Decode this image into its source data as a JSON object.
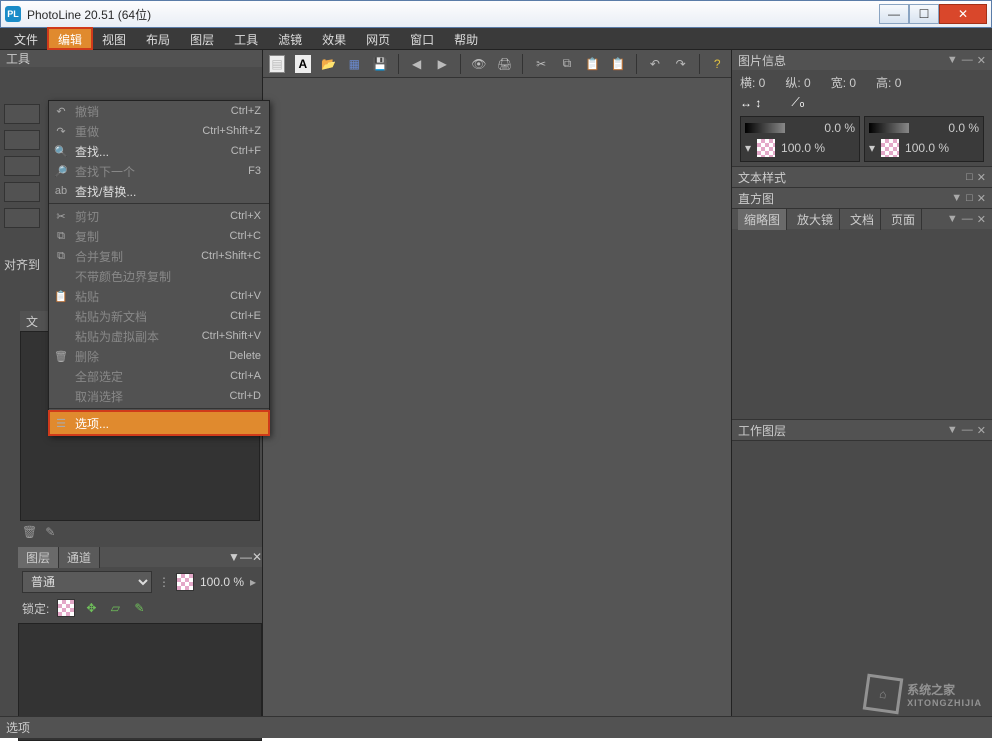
{
  "window": {
    "title": "PhotoLine 20.51 (64位)",
    "app_icon_text": "PL"
  },
  "menus": [
    "文件",
    "编辑",
    "视图",
    "布局",
    "图层",
    "工具",
    "滤镜",
    "效果",
    "网页",
    "窗口",
    "帮助"
  ],
  "active_menu_index": 1,
  "dropdown": {
    "groups": [
      [
        {
          "icon": "↶",
          "label": "撤销",
          "shortcut": "Ctrl+Z",
          "disabled": true
        },
        {
          "icon": "↷",
          "label": "重做",
          "shortcut": "Ctrl+Shift+Z",
          "disabled": true
        },
        {
          "icon": "🔍",
          "label": "查找...",
          "shortcut": "Ctrl+F"
        },
        {
          "icon": "🔎",
          "label": "查找下一个",
          "shortcut": "F3",
          "disabled": true
        },
        {
          "icon": "ab",
          "label": "查找/替换..."
        }
      ],
      [
        {
          "icon": "✂",
          "label": "剪切",
          "shortcut": "Ctrl+X",
          "disabled": true
        },
        {
          "icon": "⧉",
          "label": "复制",
          "shortcut": "Ctrl+C",
          "disabled": true
        },
        {
          "icon": "⧉",
          "label": "合并复制",
          "shortcut": "Ctrl+Shift+C",
          "disabled": true
        },
        {
          "icon": "",
          "label": "不带颜色边界复制",
          "disabled": true
        },
        {
          "icon": "📋",
          "label": "粘贴",
          "shortcut": "Ctrl+V",
          "disabled": true
        },
        {
          "icon": "",
          "label": "粘贴为新文档",
          "shortcut": "Ctrl+E",
          "disabled": true
        },
        {
          "icon": "",
          "label": "粘贴为虚拟副本",
          "shortcut": "Ctrl+Shift+V",
          "disabled": true
        },
        {
          "icon": "🗑",
          "label": "删除",
          "shortcut": "Delete",
          "disabled": true
        },
        {
          "icon": "",
          "label": "全部选定",
          "shortcut": "Ctrl+A",
          "disabled": true
        },
        {
          "icon": "",
          "label": "取消选择",
          "shortcut": "Ctrl+D",
          "disabled": true
        }
      ],
      [
        {
          "icon": "☰",
          "label": "选项...",
          "highlighted": true
        }
      ]
    ]
  },
  "left": {
    "tools_label": "工具",
    "align_label": "对齐到",
    "nav_tab": "文",
    "layer_tabs": [
      "图层",
      "通道"
    ],
    "blend_mode": "普通",
    "opacity": "100.0 %",
    "lock_label": "锁定:"
  },
  "right": {
    "img_info": {
      "title": "图片信息",
      "h": "横: 0",
      "v": "纵: 0",
      "w": "宽: 0",
      "ht": "高: 0",
      "pct1": "0.0 %",
      "pct2": "0.0 %",
      "full1": "100.0 %",
      "full2": "100.0 %"
    },
    "text_style": "文本样式",
    "histogram": "直方图",
    "thumb_tabs": [
      "缩略图",
      "放大镜",
      "文档",
      "页面"
    ],
    "work_layers": "工作图层"
  },
  "status": "选项",
  "watermark": {
    "brand": "系统之家",
    "sub": "XITONGZHIJIA"
  }
}
